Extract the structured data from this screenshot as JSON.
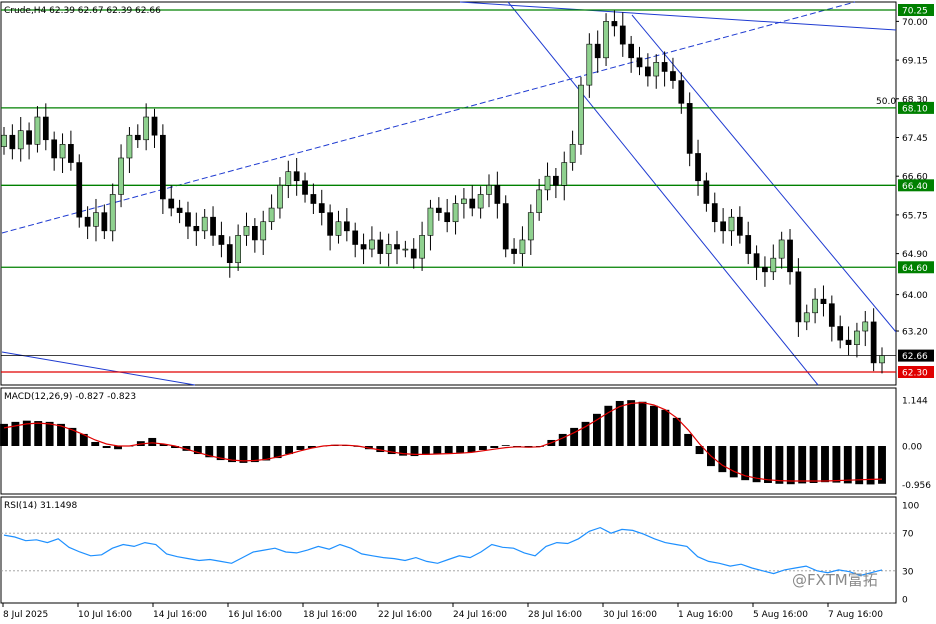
{
  "header": {
    "symbol_line": "Crude,H4  62.39 62.67 62.39 62.66",
    "fifty_label": "50.0"
  },
  "price_axis": [
    "70.25",
    "70.00",
    "69.15",
    "68.30",
    "68.10",
    "67.45",
    "66.60",
    "66.40",
    "65.75",
    "64.90",
    "64.60",
    "64.00",
    "63.20",
    "62.66",
    "62.30"
  ],
  "levels": [
    {
      "value": 70.25,
      "label": "70.25",
      "color": "#008000",
      "kind": "support-resistance"
    },
    {
      "value": 68.1,
      "label": "68.10",
      "color": "#008000",
      "kind": "support-resistance"
    },
    {
      "value": 66.4,
      "label": "66.40",
      "color": "#008000",
      "kind": "support-resistance"
    },
    {
      "value": 64.6,
      "label": "64.60",
      "color": "#008000",
      "kind": "support-resistance"
    },
    {
      "value": 62.3,
      "label": "62.30",
      "color": "#e00000",
      "kind": "red-level"
    },
    {
      "value": 62.66,
      "label": "62.66",
      "color": "#000000",
      "kind": "current-price"
    }
  ],
  "macd": {
    "title": "MACD(12,26,9) -0.827 -0.823",
    "axis": [
      "1.144",
      "0.00",
      "-0.956"
    ]
  },
  "rsi": {
    "title": "RSI(14) 31.1498",
    "axis": [
      "100",
      "70",
      "30",
      "0"
    ]
  },
  "time_axis": [
    "8 Jul 2025",
    "10 Jul 16:00",
    "14 Jul 16:00",
    "16 Jul 16:00",
    "18 Jul 16:00",
    "22 Jul 16:00",
    "24 Jul 16:00",
    "28 Jul 16:00",
    "30 Jul 16:00",
    "1 Aug 16:00",
    "5 Aug 16:00",
    "7 Aug 16:00"
  ],
  "watermark": "@FXTM富拓",
  "colors": {
    "green_line": "#008000",
    "red_line": "#e00000",
    "trend": "#1f3bd1",
    "signal": "#e00000",
    "rsi": "#1e90ff"
  },
  "chart_data": {
    "type": "candlestick",
    "symbol": "Crude",
    "timeframe": "H4",
    "ohlc_last": {
      "open": 62.39,
      "high": 62.67,
      "low": 62.39,
      "close": 62.66
    },
    "y_range": [
      61.85,
      70.35
    ],
    "closes": [
      67.5,
      67.2,
      67.6,
      67.3,
      67.9,
      67.4,
      67.0,
      67.3,
      66.9,
      65.7,
      65.5,
      65.8,
      65.4,
      66.2,
      67.0,
      67.5,
      67.4,
      67.9,
      67.5,
      66.1,
      65.9,
      65.8,
      65.5,
      65.4,
      65.7,
      65.3,
      65.1,
      64.7,
      65.3,
      65.5,
      65.2,
      65.6,
      65.9,
      66.4,
      66.7,
      66.5,
      66.2,
      66.0,
      65.8,
      65.3,
      65.6,
      65.4,
      65.1,
      65.0,
      65.2,
      64.9,
      65.1,
      65.0,
      65.0,
      64.8,
      65.3,
      65.9,
      65.8,
      65.6,
      66.0,
      66.1,
      65.9,
      66.2,
      66.4,
      66.0,
      65.0,
      64.9,
      65.2,
      65.8,
      66.3,
      66.6,
      66.4,
      66.9,
      67.3,
      68.6,
      69.5,
      69.2,
      70.0,
      69.9,
      69.5,
      69.2,
      69.0,
      68.8,
      69.1,
      68.9,
      68.7,
      68.2,
      67.1,
      66.5,
      66.0,
      65.6,
      65.4,
      65.7,
      65.3,
      64.9,
      64.6,
      64.5,
      64.8,
      65.2,
      64.5,
      63.4,
      63.6,
      63.9,
      63.8,
      63.3,
      63.0,
      62.9,
      63.2,
      63.4,
      62.5,
      62.66
    ],
    "macd_histogram": [
      0.55,
      0.6,
      0.63,
      0.62,
      0.6,
      0.55,
      0.45,
      0.3,
      0.1,
      -0.05,
      -0.08,
      0.0,
      0.12,
      0.2,
      0.05,
      -0.05,
      -0.12,
      -0.2,
      -0.28,
      -0.35,
      -0.4,
      -0.42,
      -0.4,
      -0.36,
      -0.3,
      -0.2,
      -0.1,
      -0.05,
      0.0,
      0.03,
      0.02,
      -0.02,
      -0.08,
      -0.15,
      -0.2,
      -0.24,
      -0.25,
      -0.22,
      -0.2,
      -0.18,
      -0.17,
      -0.15,
      -0.1,
      -0.05,
      0.02,
      -0.02,
      -0.04,
      -0.02,
      0.15,
      0.3,
      0.45,
      0.6,
      0.8,
      1.0,
      1.12,
      1.14,
      1.1,
      1.0,
      0.9,
      0.7,
      0.3,
      -0.2,
      -0.5,
      -0.65,
      -0.78,
      -0.85,
      -0.9,
      -0.92,
      -0.94,
      -0.95,
      -0.93,
      -0.92,
      -0.9,
      -0.91,
      -0.93,
      -0.95,
      -0.956,
      -0.94
    ],
    "macd_signal": [
      0.45,
      0.5,
      0.55,
      0.57,
      0.55,
      0.5,
      0.4,
      0.28,
      0.15,
      0.05,
      0.0,
      0.0,
      0.05,
      0.08,
      0.05,
      0.0,
      -0.08,
      -0.16,
      -0.24,
      -0.3,
      -0.35,
      -0.37,
      -0.36,
      -0.33,
      -0.27,
      -0.2,
      -0.12,
      -0.05,
      0.0,
      0.02,
      0.02,
      0.0,
      -0.05,
      -0.1,
      -0.15,
      -0.19,
      -0.21,
      -0.21,
      -0.2,
      -0.19,
      -0.18,
      -0.16,
      -0.12,
      -0.08,
      -0.04,
      -0.02,
      -0.03,
      -0.02,
      0.08,
      0.2,
      0.33,
      0.48,
      0.65,
      0.83,
      0.98,
      1.06,
      1.08,
      1.02,
      0.9,
      0.7,
      0.4,
      0.05,
      -0.25,
      -0.48,
      -0.63,
      -0.74,
      -0.8,
      -0.84,
      -0.86,
      -0.87,
      -0.87,
      -0.87,
      -0.87,
      -0.86,
      -0.85,
      -0.84,
      -0.83,
      -0.823
    ],
    "rsi": [
      68,
      66,
      62,
      63,
      60,
      64,
      55,
      50,
      46,
      47,
      54,
      58,
      56,
      60,
      58,
      48,
      45,
      43,
      41,
      42,
      40,
      38,
      44,
      50,
      52,
      54,
      50,
      49,
      52,
      56,
      53,
      58,
      54,
      48,
      46,
      44,
      43,
      41,
      44,
      40,
      38,
      42,
      46,
      44,
      50,
      58,
      55,
      54,
      49,
      46,
      56,
      60,
      59,
      64,
      72,
      76,
      70,
      74,
      73,
      69,
      64,
      60,
      58,
      56,
      45,
      40,
      38,
      35,
      37,
      33,
      30,
      27,
      31,
      33,
      35,
      30,
      28,
      31,
      29,
      25,
      28,
      31
    ],
    "rsi_levels": [
      70,
      30
    ]
  }
}
